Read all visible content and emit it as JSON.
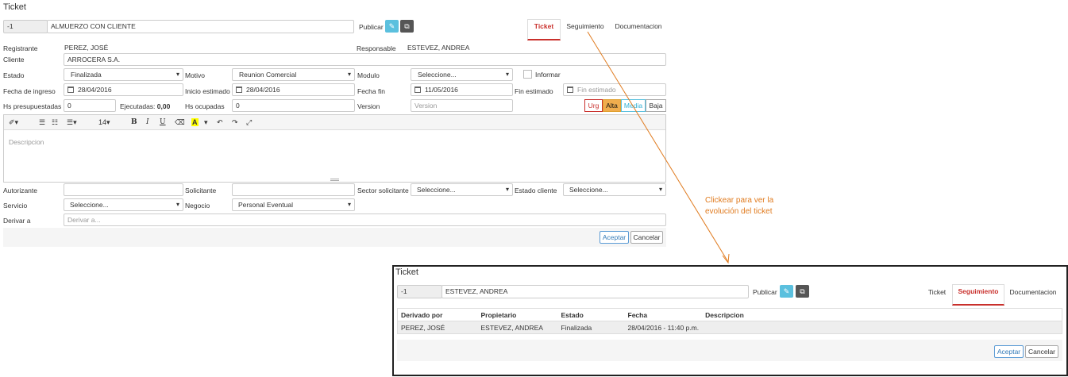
{
  "ticket": {
    "title": "Ticket",
    "id": "-1",
    "subject": "ALMUERZO CON CLIENTE",
    "publish_label": "Publicar",
    "tabs": [
      "Ticket",
      "Seguimiento",
      "Documentacion"
    ],
    "fields": {
      "registrante_label": "Registrante",
      "registrante_value": "PEREZ, JOSÉ",
      "responsable_label": "Responsable",
      "responsable_value": "ESTEVEZ, ANDREA",
      "cliente_label": "Cliente",
      "cliente_value": "ARROCERA S.A.",
      "estado_label": "Estado",
      "estado_value": "Finalizada",
      "motivo_label": "Motivo",
      "motivo_value": "Reunion Comercial",
      "modulo_label": "Modulo",
      "modulo_value": "Seleccione...",
      "informar_label": "Informar",
      "fecha_ingreso_label": "Fecha de ingreso",
      "fecha_ingreso_value": "28/04/2016",
      "inicio_estimado_label": "Inicio estimado",
      "inicio_estimado_value": "28/04/2016",
      "fecha_fin_label": "Fecha fin",
      "fecha_fin_value": "11/05/2016",
      "fin_estimado_label": "Fin estimado",
      "fin_estimado_placeholder": "Fin estimado",
      "hs_presupuestadas_label": "Hs presupuestadas",
      "hs_presupuestadas_value": "0",
      "ejecutadas_label": "Ejecutadas:",
      "ejecutadas_value": "0,00",
      "hs_ocupadas_label": "Hs ocupadas",
      "hs_ocupadas_value": "0",
      "version_label": "Version",
      "version_placeholder": "Version",
      "priority": [
        "Urg",
        "Alta",
        "Media",
        "Baja"
      ],
      "descripcion_placeholder": "Descripcion",
      "font_size": "14",
      "autorizante_label": "Autorizante",
      "solicitante_label": "Solicitante",
      "sector_label": "Sector solicitante",
      "sector_value": "Seleccione...",
      "estado_cliente_label": "Estado cliente",
      "estado_cliente_value": "Seleccione...",
      "servicio_label": "Servicio",
      "servicio_value": "Seleccione...",
      "negocio_label": "Negocio",
      "negocio_value": "Personal Eventual",
      "derivar_label": "Derivar a",
      "derivar_placeholder": "Derivar a..."
    },
    "accept_label": "Aceptar",
    "cancel_label": "Cancelar"
  },
  "annotation": {
    "line1": "Clickear para ver la",
    "line2": "evolución del ticket",
    "color": "#e07b1f"
  },
  "popup": {
    "title": "Ticket",
    "id": "-1",
    "subject": "ESTEVEZ, ANDREA",
    "publish_label": "Publicar",
    "tabs": [
      "Ticket",
      "Seguimiento",
      "Documentacion"
    ],
    "table": {
      "headers": [
        "Derivado por",
        "Propietario",
        "Estado",
        "Fecha",
        "Descripcion"
      ],
      "rows": [
        [
          "PEREZ, JOSÉ",
          "ESTEVEZ, ANDREA",
          "Finalizada",
          "28/04/2016 - 11:40 p.m.",
          ""
        ]
      ]
    },
    "accept_label": "Aceptar",
    "cancel_label": "Cancelar"
  }
}
